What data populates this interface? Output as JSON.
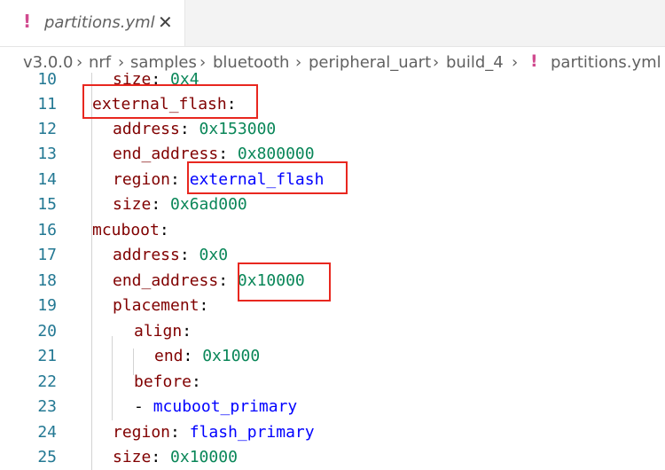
{
  "tab": {
    "icon": "!",
    "label": "partitions.yml",
    "close": "✕"
  },
  "breadcrumb": {
    "items": [
      "v3.0.0",
      "nrf",
      "samples",
      "bluetooth",
      "peripheral_uart",
      "build_4"
    ],
    "separator": "›",
    "file_icon": "!",
    "file": "partitions.yml"
  },
  "lines": [
    {
      "n": "10",
      "key": "size",
      "value": "0x4",
      "vtype": "num"
    },
    {
      "n": "11",
      "key": "external_flash",
      "value": "",
      "vtype": ""
    },
    {
      "n": "12",
      "key": "address",
      "value": "0x153000",
      "vtype": "num"
    },
    {
      "n": "13",
      "key": "end_address",
      "value": "0x800000",
      "vtype": "num"
    },
    {
      "n": "14",
      "key": "region",
      "value": "external_flash",
      "vtype": "str"
    },
    {
      "n": "15",
      "key": "size",
      "value": "0x6ad000",
      "vtype": "num"
    },
    {
      "n": "16",
      "key": "mcuboot",
      "value": "",
      "vtype": ""
    },
    {
      "n": "17",
      "key": "address",
      "value": "0x0",
      "vtype": "num"
    },
    {
      "n": "18",
      "key": "end_address",
      "value": "0x10000",
      "vtype": "num"
    },
    {
      "n": "19",
      "key": "placement",
      "value": "",
      "vtype": ""
    },
    {
      "n": "20",
      "key": "align",
      "value": "",
      "vtype": ""
    },
    {
      "n": "21",
      "key": "end",
      "value": "0x1000",
      "vtype": "num"
    },
    {
      "n": "22",
      "key": "before",
      "value": "",
      "vtype": ""
    },
    {
      "n": "23",
      "key": "",
      "value": "mcuboot_primary",
      "vtype": "str",
      "dash": "-"
    },
    {
      "n": "24",
      "key": "region",
      "value": "flash_primary",
      "vtype": "str"
    },
    {
      "n": "25",
      "key": "size",
      "value": "0x10000",
      "vtype": "num"
    }
  ],
  "colors": {
    "highlight": "#e8271f",
    "key": "#800000",
    "number": "#098658",
    "string": "#0000ff",
    "line_number": "#237893"
  }
}
